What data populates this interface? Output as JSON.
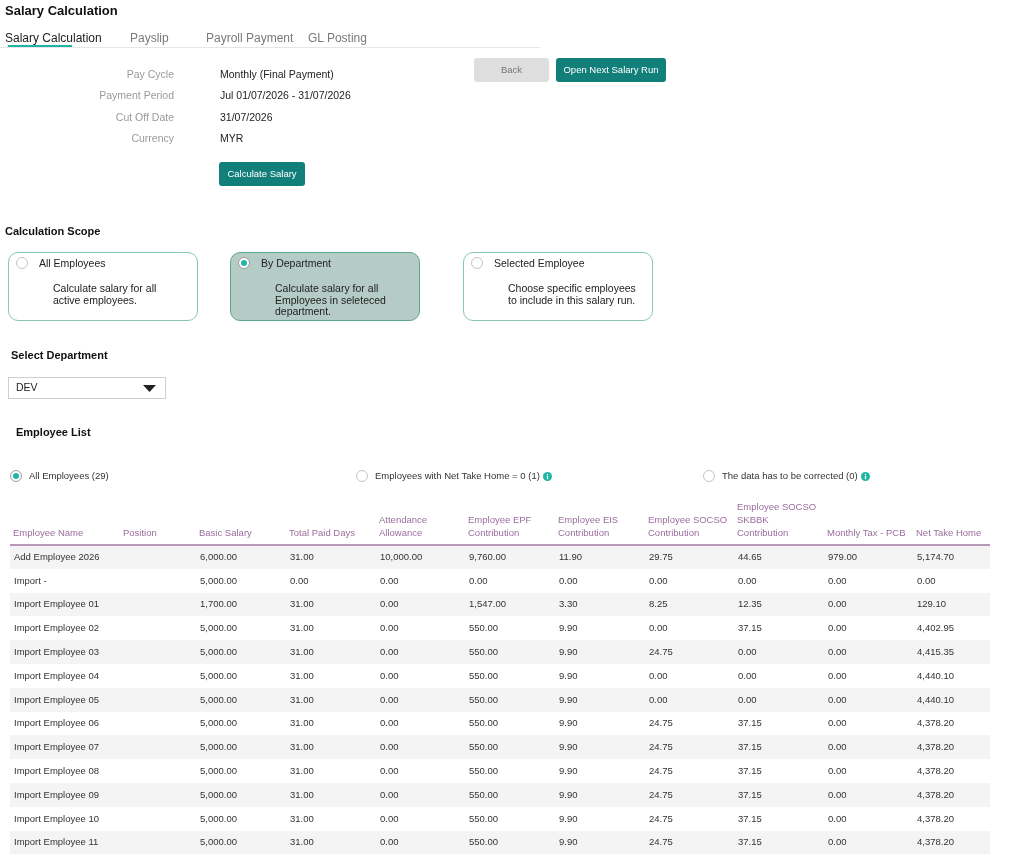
{
  "page": {
    "title": "Salary Calculation"
  },
  "tabs": [
    {
      "label": "Salary Calculation",
      "selected": true
    },
    {
      "label": "Payslip",
      "selected": false
    },
    {
      "label": "Payroll Payment",
      "selected": false
    },
    {
      "label": "GL Posting",
      "selected": false
    }
  ],
  "details": [
    {
      "label": "Pay Cycle",
      "value": "Monthly (Final Payment)"
    },
    {
      "label": "Payment Period",
      "value": "Jul 01/07/2026 - 31/07/2026"
    },
    {
      "label": "Cut Off Date",
      "value": "31/07/2026"
    },
    {
      "label": "Currency",
      "value": "MYR"
    }
  ],
  "header_buttons": [
    {
      "label": "Back",
      "kind": "secondary"
    },
    {
      "label": "Open Next Salary Run",
      "kind": "primary"
    }
  ],
  "calculate_button": {
    "label": "Calculate Salary",
    "kind": "primary"
  },
  "calculation_scope": {
    "title": "Calculation Scope",
    "options": [
      {
        "title": "All Employees",
        "description_lines": [
          "Calculate salary for all",
          "active employees."
        ],
        "selected": false
      },
      {
        "title": "By Department",
        "description_lines": [
          "Calculate salary for all",
          "Employees in seleteced",
          "department."
        ],
        "selected": true
      },
      {
        "title": "Selected Employee",
        "description_lines": [
          "Choose specific employees",
          "to include in this salary run."
        ],
        "selected": false
      }
    ]
  },
  "department": {
    "title": "Select Department",
    "value": "DEV"
  },
  "employee_list": {
    "title": "Employee List",
    "filters": [
      {
        "label": "All Employees (29)",
        "selected": true,
        "info": false
      },
      {
        "label": "Employees with Net Take Home = 0 (1)",
        "selected": false,
        "info": true
      },
      {
        "label": "The data has to be corrected (0)",
        "selected": false,
        "info": true
      }
    ],
    "columns": [
      "Employee Name",
      "Position",
      "Basic Salary",
      "Total Paid Days",
      "Attendance Allowance",
      "Employee EPF Contribution",
      "Employee EIS Contribution",
      "Employee SOCSO Contribution",
      "Employee SOCSO SKBBK Contribution",
      "Monthly Tax - PCB",
      "Net Take Home"
    ],
    "rows": [
      [
        "Add Employee 2026",
        null,
        "6,000.00",
        "31.00",
        "10,000.00",
        "9,760.00",
        "11.90",
        "29.75",
        "44.65",
        "979.00",
        "5,174.70"
      ],
      [
        "Import -",
        null,
        "5,000.00",
        "0.00",
        "0.00",
        "0.00",
        "0.00",
        "0.00",
        "0.00",
        "0.00",
        "0.00"
      ],
      [
        "Import Employee 01",
        null,
        "1,700.00",
        "31.00",
        "0.00",
        "1,547.00",
        "3.30",
        "8.25",
        "12.35",
        "0.00",
        "129.10"
      ],
      [
        "Import Employee 02",
        null,
        "5,000.00",
        "31.00",
        "0.00",
        "550.00",
        "9.90",
        "0.00",
        "37.15",
        "0.00",
        "4,402.95"
      ],
      [
        "Import Employee 03",
        null,
        "5,000.00",
        "31.00",
        "0.00",
        "550.00",
        "9.90",
        "24.75",
        "0.00",
        "0.00",
        "4,415.35"
      ],
      [
        "Import Employee 04",
        null,
        "5,000.00",
        "31.00",
        "0.00",
        "550.00",
        "9.90",
        "0.00",
        "0.00",
        "0.00",
        "4,440.10"
      ],
      [
        "Import Employee 05",
        null,
        "5,000.00",
        "31.00",
        "0.00",
        "550.00",
        "9.90",
        "0.00",
        "0.00",
        "0.00",
        "4,440.10"
      ],
      [
        "Import Employee 06",
        null,
        "5,000.00",
        "31.00",
        "0.00",
        "550.00",
        "9.90",
        "24.75",
        "37.15",
        "0.00",
        "4,378.20"
      ],
      [
        "Import Employee 07",
        null,
        "5,000.00",
        "31.00",
        "0.00",
        "550.00",
        "9.90",
        "24.75",
        "37.15",
        "0.00",
        "4,378.20"
      ],
      [
        "Import Employee 08",
        null,
        "5,000.00",
        "31.00",
        "0.00",
        "550.00",
        "9.90",
        "24.75",
        "37.15",
        "0.00",
        "4,378.20"
      ],
      [
        "Import Employee 09",
        null,
        "5,000.00",
        "31.00",
        "0.00",
        "550.00",
        "9.90",
        "24.75",
        "37.15",
        "0.00",
        "4,378.20"
      ],
      [
        "Import Employee 10",
        null,
        "5,000.00",
        "31.00",
        "0.00",
        "550.00",
        "9.90",
        "24.75",
        "37.15",
        "0.00",
        "4,378.20"
      ],
      [
        "Import Employee 11",
        null,
        "5,000.00",
        "31.00",
        "0.00",
        "550.00",
        "9.90",
        "24.75",
        "37.15",
        "0.00",
        "4,378.20"
      ]
    ]
  }
}
